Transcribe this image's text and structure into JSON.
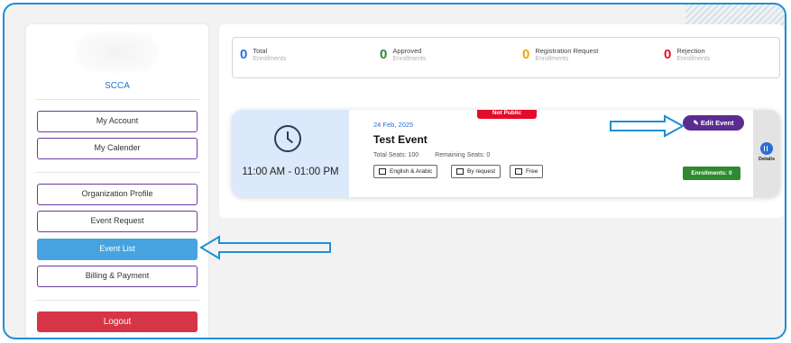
{
  "sidebar": {
    "org_name": "SCCA",
    "items": [
      {
        "label": "My Account"
      },
      {
        "label": "My Calender"
      },
      {
        "label": "Organization Profile"
      },
      {
        "label": "Event Request"
      },
      {
        "label": "Event List",
        "active": true
      },
      {
        "label": "Billing & Payment"
      }
    ],
    "logout_label": "Logout"
  },
  "stats": [
    {
      "value": "0",
      "label": "Total",
      "sub": "Enrollments",
      "color": "#2a6fd6"
    },
    {
      "value": "0",
      "label": "Approved",
      "sub": "Enrollments",
      "color": "#2f8a2f"
    },
    {
      "value": "0",
      "label": "Registration Request",
      "sub": "Enrollments",
      "color": "#f2a20c"
    },
    {
      "value": "0",
      "label": "Rejection",
      "sub": "Enrollments",
      "color": "#e30c2b"
    }
  ],
  "event": {
    "time": "11:00 AM - 01:00 PM",
    "date": "24 Feb, 2025",
    "title": "Test Event",
    "total_seats": "Total Seats: 100",
    "remaining_seats": "Remaining Seats: 0",
    "tags": [
      "English & Arabic",
      "By request",
      "Free"
    ],
    "visibility_badge": "Not Public",
    "edit_label": "Edit Event",
    "enrollments_label": "Enrollments: 0",
    "details_label": "Details"
  },
  "colors": {
    "accent_purple": "#5b2d91",
    "active_blue": "#47a3df",
    "logout_red": "#d63447",
    "arrow_blue": "#1e90d6"
  }
}
